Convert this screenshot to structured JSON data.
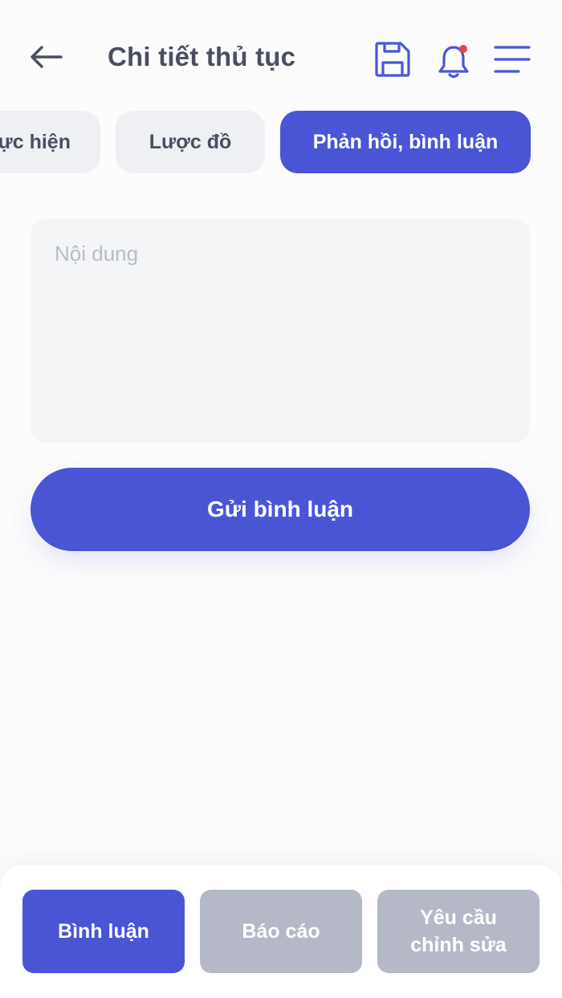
{
  "header": {
    "title": "Chi tiết thủ tục",
    "icons": [
      "arrow-left-icon",
      "save-icon",
      "bell-icon",
      "menu-icon"
    ],
    "has_notification_dot": true
  },
  "tabs": [
    {
      "label": "Cách thức thực hiện",
      "visible_label": "ực hiện",
      "active": false
    },
    {
      "label": "Lược đồ",
      "active": false
    },
    {
      "label": "Phản hồi, bình luận",
      "active": true
    }
  ],
  "form": {
    "content_placeholder": "Nội dung",
    "content_value": "",
    "submit_label": "Gửi bình luận"
  },
  "bottom_nav": [
    {
      "label": "Bình luận",
      "active": true
    },
    {
      "label": "Báo cáo",
      "active": false
    },
    {
      "label": "Yêu cầu chỉnh sửa",
      "active": false
    }
  ],
  "colors": {
    "accent": "#4a55d6",
    "muted": "#b5b8c7",
    "text": "#4a4f60",
    "notification": "#e0474c",
    "input_bg": "#f4f5f7"
  }
}
